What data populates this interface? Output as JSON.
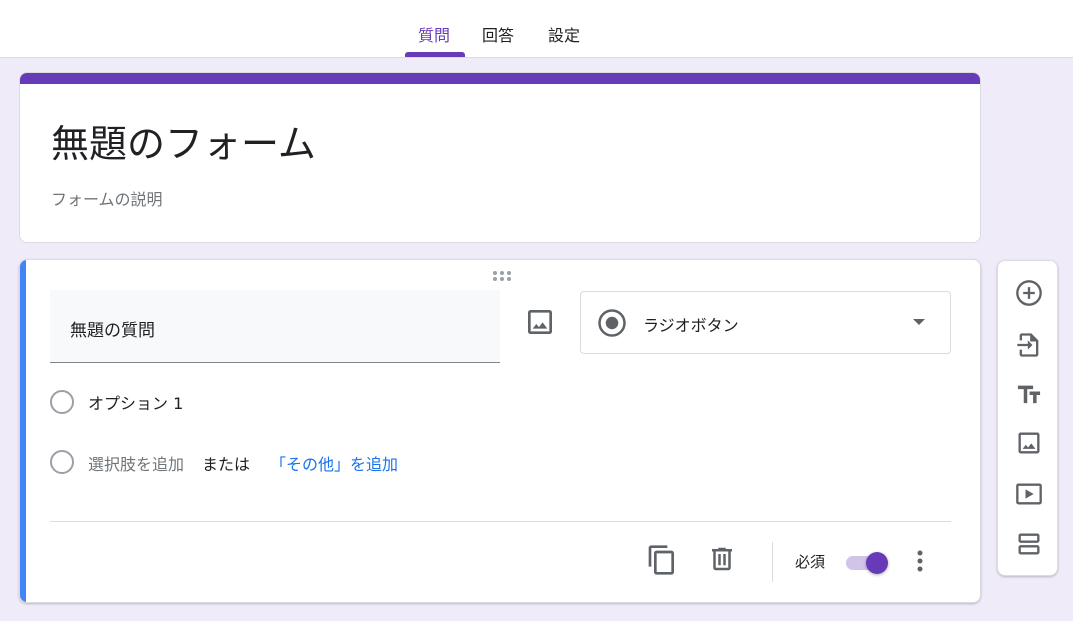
{
  "tabs": [
    {
      "label": "質問",
      "active": true
    },
    {
      "label": "回答",
      "active": false
    },
    {
      "label": "設定",
      "active": false
    }
  ],
  "form": {
    "title": "無題のフォーム",
    "description": "フォームの説明"
  },
  "question": {
    "title": "無題の質問",
    "type_label": "ラジオボタン",
    "options": [
      "オプション 1"
    ],
    "add_option_label": "選択肢を追加",
    "or_label": "または",
    "add_other_label": "「その他」を追加",
    "required_label": "必須",
    "required_on": true
  },
  "colors": {
    "accent": "#673ab7",
    "active_question_bar": "#4285f4",
    "link": "#1a73e8",
    "background": "#f0ebf8"
  },
  "sidebar": {
    "icons": [
      "add-question-icon",
      "import-questions-icon",
      "add-title-icon",
      "add-image-icon",
      "add-video-icon",
      "add-section-icon"
    ]
  }
}
